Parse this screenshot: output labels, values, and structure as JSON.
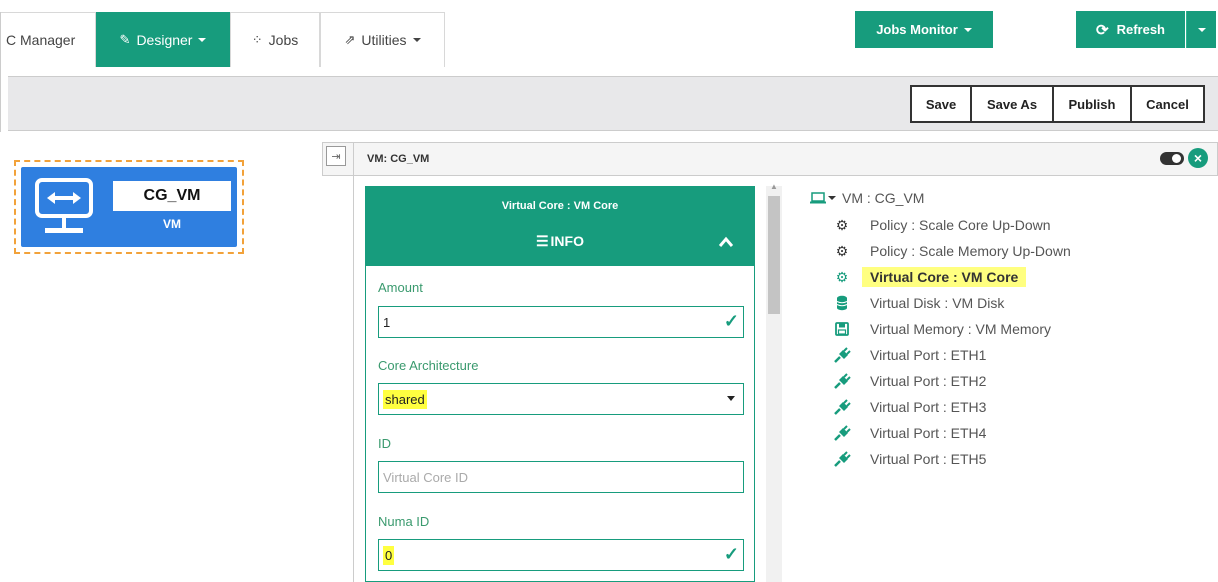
{
  "nav": {
    "tabs": [
      {
        "label": "C Manager",
        "icon": "none"
      },
      {
        "label": "Designer",
        "icon": "edit-icon"
      },
      {
        "label": "Jobs",
        "icon": "spinner-icon"
      },
      {
        "label": "Utilities",
        "icon": "external-link-icon"
      }
    ],
    "jobs_monitor_label": "Jobs Monitor",
    "refresh_label": "Refresh"
  },
  "toolbar": {
    "save_label": "Save",
    "save_as_label": "Save As",
    "publish_label": "Publish",
    "cancel_label": "Cancel"
  },
  "canvas": {
    "vm_name": "CG_VM",
    "vm_type": "VM"
  },
  "panel": {
    "title": "VM: CG_VM"
  },
  "form": {
    "header": "Virtual Core : VM Core",
    "tab_label": "INFO",
    "amount_label": "Amount",
    "amount_value": "1",
    "core_arch_label": "Core Architecture",
    "core_arch_value": "shared",
    "id_label": "ID",
    "id_placeholder": "Virtual Core ID",
    "numa_label": "Numa ID",
    "numa_value": "0"
  },
  "tree": {
    "root": "VM : CG_VM",
    "items": [
      {
        "label": "Policy : Scale Core Up-Down",
        "icon": "gears-icon"
      },
      {
        "label": "Policy : Scale Memory Up-Down",
        "icon": "gears-icon"
      },
      {
        "label": "Virtual Core : VM Core",
        "icon": "gear-icon",
        "selected": true
      },
      {
        "label": "Virtual Disk : VM Disk",
        "icon": "database-icon"
      },
      {
        "label": "Virtual Memory : VM Memory",
        "icon": "floppy-icon"
      },
      {
        "label": "Virtual Port : ETH1",
        "icon": "plug-icon"
      },
      {
        "label": "Virtual Port : ETH2",
        "icon": "plug-icon"
      },
      {
        "label": "Virtual Port : ETH3",
        "icon": "plug-icon"
      },
      {
        "label": "Virtual Port : ETH4",
        "icon": "plug-icon"
      },
      {
        "label": "Virtual Port : ETH5",
        "icon": "plug-icon"
      }
    ]
  },
  "colors": {
    "accent": "#179c7d",
    "vm_blue": "#2f7fe0",
    "highlight": "#ffff40",
    "selection_border": "#f2a23a"
  }
}
